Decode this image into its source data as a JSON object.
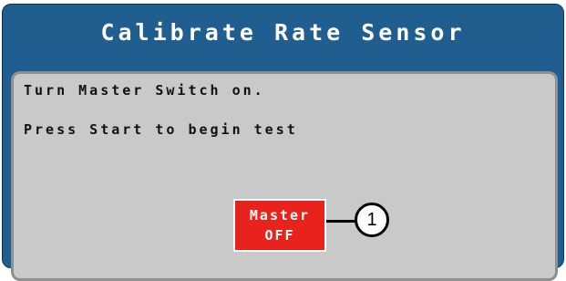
{
  "window": {
    "title": "Calibrate Rate Sensor"
  },
  "panel": {
    "instruction_1": "Turn Master Switch on.",
    "instruction_2": "Press Start to begin test"
  },
  "master_button": {
    "line_1": "Master",
    "line_2": "OFF",
    "status_color": "#e8221c"
  },
  "callout": {
    "label": "1"
  },
  "colors": {
    "header_blue": "#1f5e8e",
    "panel_gray": "#c9c9c9"
  }
}
